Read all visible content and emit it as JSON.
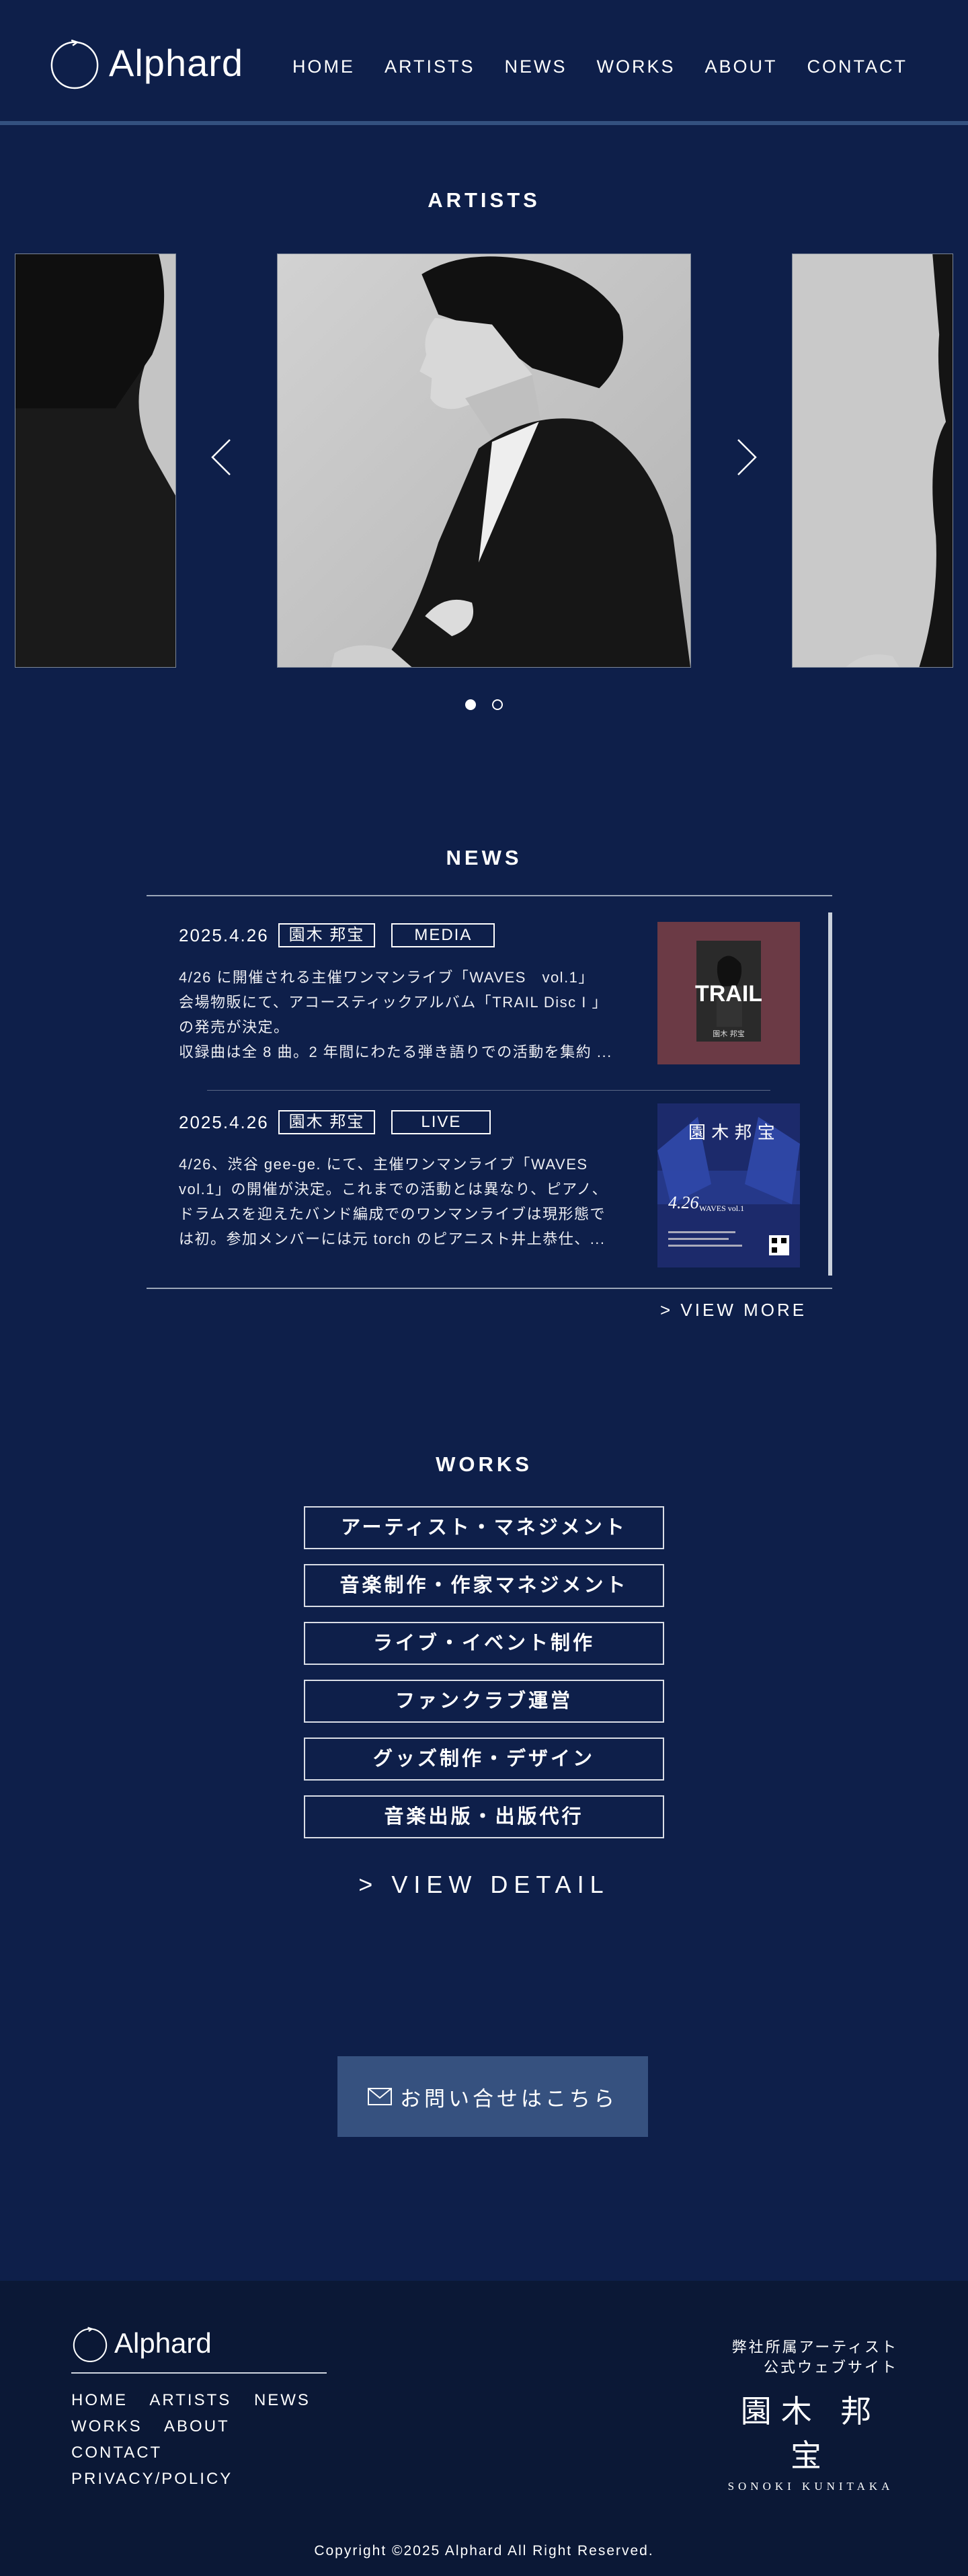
{
  "header": {
    "logo_text": "Alphard",
    "nav": [
      "HOME",
      "ARTISTS",
      "NEWS",
      "WORKS",
      "ABOUT",
      "CONTACT"
    ]
  },
  "artists": {
    "title": "ARTISTS",
    "slides": 2,
    "active_slide": 1
  },
  "news": {
    "title": "NEWS",
    "items": [
      {
        "date": "2025.4.26",
        "artist_tag": "園木 邦宝",
        "category": "MEDIA",
        "lines": [
          "4/26 に開催される主催ワンマンライブ「WAVES　vol.1」",
          "会場物販にて、アコースティックアルバム「TRAIL Disc I 」",
          "の発売が決定。",
          "収録曲は全 8 曲。2 年間にわたる弾き語りでの活動を集約 ..."
        ],
        "thumb_title": "TRAIL",
        "thumb_sub": "園木 邦宝"
      },
      {
        "date": "2025.4.26",
        "artist_tag": "園木 邦宝",
        "category": "LIVE",
        "lines": [
          "4/26、渋谷 gee-ge. にて、主催ワンマンライブ「WAVES",
          "vol.1」の開催が決定。これまでの活動とは異なり、ピアノ、",
          "ドラムスを迎えたバンド編成でのワンマンライブは現形態で",
          "は初。参加メンバーには元 torch のピアニスト井上恭仕、..."
        ],
        "thumb_title": "園 木 邦 宝",
        "thumb_date": "4.26",
        "thumb_event": "WAVES vol.1"
      }
    ],
    "view_more": "> VIEW MORE"
  },
  "works": {
    "title": "WORKS",
    "items": [
      "アーティスト・マネジメント",
      "音楽制作・作家マネジメント",
      "ライブ・イベント制作",
      "ファンクラブ運営",
      "グッズ制作・デザイン",
      "音楽出版・出版代行"
    ],
    "view_detail": "> VIEW DETAIL"
  },
  "contact": {
    "label": "お問い合せはこちら"
  },
  "footer": {
    "logo_text": "Alphard",
    "nav_row1": [
      "HOME",
      "ARTISTS",
      "NEWS"
    ],
    "nav_row2": [
      "WORKS",
      "ABOUT",
      "CONTACT"
    ],
    "nav_row3": [
      "PRIVACY/POLICY"
    ],
    "site_label_1": "弊社所属アーティスト",
    "site_label_2": "公式ウェブサイト",
    "artist_name_jp": "園木 邦宝",
    "artist_name_en": "SONOKI KUNITAKA",
    "copyright": "Copyright ©2025 Alphard All Right Reserved."
  },
  "colors": {
    "background": "#0e1f4a",
    "header_rule": "#33507f",
    "contact_button": "#36517f",
    "footer_bg": "#0b1836"
  }
}
